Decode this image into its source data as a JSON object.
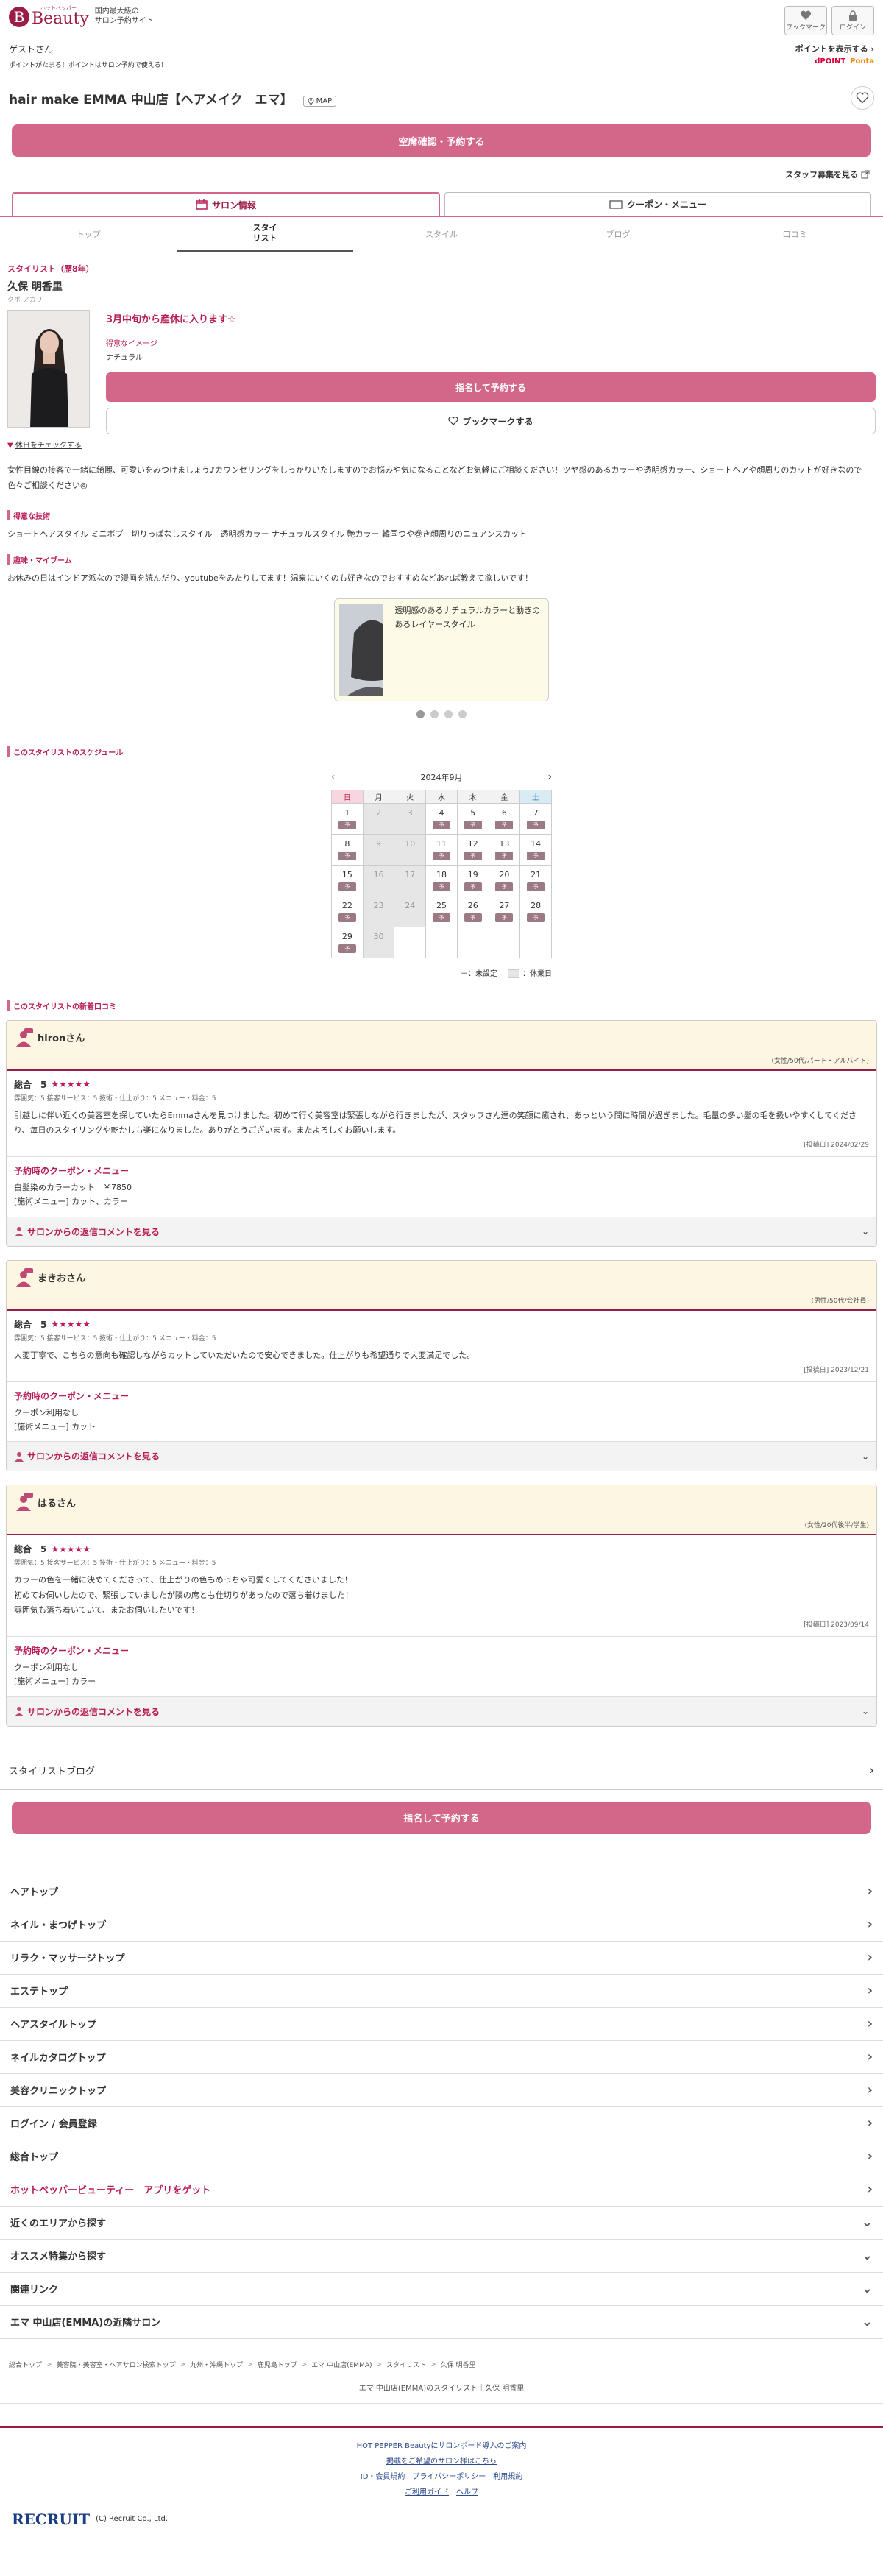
{
  "header": {
    "logo_small": "ホットペッパー",
    "logo_word": "Beauty",
    "logo_mark": "B",
    "tagline1": "国内最大級の",
    "tagline2": "サロン予約サイト",
    "bookmark": "ブックマーク",
    "login": "ログイン",
    "guest": "ゲストさん",
    "point_note": "ポイントがたまる！ポイントはサロン予約で使える！",
    "point_show": "ポイントを表示する",
    "dpoint": "dPOINT",
    "ponta": "Ponta"
  },
  "salon": {
    "name": "hair make EMMA 中山店【ヘアメイク　エマ】",
    "map": "MAP",
    "reserve": "空席確認・予約する",
    "staff_photos": "スタッフ募集を見る"
  },
  "tabs": [
    "サロン情報",
    "クーポン・メニュー"
  ],
  "subtabs": [
    "トップ",
    "スタイ\nリスト",
    "スタイル",
    "ブログ",
    "口コミ"
  ],
  "stylist": {
    "role": "スタイリスト（歴8年）",
    "name": "久保 明香里",
    "kana": "クボ アカリ",
    "catch": "3月中旬から産休に入ります☆",
    "image_label": "得意なイメージ",
    "image_value": "ナチュラル",
    "nominate": "指名して予約する",
    "bookmark": "ブックマークする",
    "holiday": "休日をチェックする",
    "pr": "女性目線の接客で一緒に綺麗、可愛いをみつけましょう♪カウンセリングをしっかりいたしますのでお悩みや気になることなどお気軽にご相談ください！ツヤ感のあるカラーや透明感カラー、ショートヘアや顔周りのカットが好きなので色々ご相談ください◎"
  },
  "skills": {
    "title": "得意な技術",
    "text": "ショートヘアスタイル ミニボブ　切りっぱなしスタイル　透明感カラー ナチュラルスタイル 艶カラー 韓国つや巻き顔周りのニュアンスカット"
  },
  "hobby": {
    "title": "趣味・マイブーム",
    "text": "お休みの日はインドア派なので漫画を読んだり、youtubeをみたりしてます！温泉にいくのも好きなのでおすすめなどあれば教えて欲しいです！"
  },
  "style_card": {
    "desc": "透明感のあるナチュラルカラーと動きのあるレイヤースタイル"
  },
  "schedule": {
    "title": "このスタイリストのスケジュール",
    "month": "2024年9月",
    "dow": [
      "日",
      "月",
      "火",
      "水",
      "木",
      "金",
      "土"
    ],
    "rows": [
      [
        [
          "1",
          "ok"
        ],
        [
          "2",
          "off"
        ],
        [
          "3",
          "off"
        ],
        [
          "4",
          "ok"
        ],
        [
          "5",
          "ok"
        ],
        [
          "6",
          "ok"
        ],
        [
          "7",
          "ok"
        ]
      ],
      [
        [
          "8",
          "ok"
        ],
        [
          "9",
          "off"
        ],
        [
          "10",
          "off"
        ],
        [
          "11",
          "ok"
        ],
        [
          "12",
          "ok"
        ],
        [
          "13",
          "ok"
        ],
        [
          "14",
          "ok"
        ]
      ],
      [
        [
          "15",
          "ok"
        ],
        [
          "16",
          "off"
        ],
        [
          "17",
          "off"
        ],
        [
          "18",
          "ok"
        ],
        [
          "19",
          "ok"
        ],
        [
          "20",
          "ok"
        ],
        [
          "21",
          "ok"
        ]
      ],
      [
        [
          "22",
          "ok"
        ],
        [
          "23",
          "off"
        ],
        [
          "24",
          "off"
        ],
        [
          "25",
          "ok"
        ],
        [
          "26",
          "ok"
        ],
        [
          "27",
          "ok"
        ],
        [
          "28",
          "ok"
        ]
      ],
      [
        [
          "29",
          "ok"
        ],
        [
          "30",
          "off"
        ],
        [
          "",
          "empty"
        ],
        [
          "",
          "empty"
        ],
        [
          "",
          "empty"
        ],
        [
          "",
          "empty"
        ],
        [
          "",
          "empty"
        ]
      ]
    ],
    "chip": "予",
    "legend_unset": "－：未設定",
    "legend_holiday": "：休業日"
  },
  "reviews": {
    "title": "このスタイリストの新着口コミ",
    "coupon_title": "予約時のクーポン・メニュー",
    "reply": "サロンからの返信コメントを見る",
    "items": [
      {
        "user": "hironさん",
        "attr": "(女性/50代/パート・アルバイト)",
        "total": "総合　5",
        "stars": "★★★★★",
        "sub": "雰囲気：5 接客サービス：5 技術・仕上がり：5 メニュー・料金：5",
        "text": "引越しに伴い近くの美容室を探していたらEmmaさんを見つけました。初めて行く美容室は緊張しながら行きましたが、スタッフさん達の笑顔に癒され、あっという間に時間が過ぎました。毛量の多い髪の毛を扱いやすくしてくださり、毎日のスタイリングや乾かしも楽になりました。ありがとうございます。またよろしくお願いします。",
        "date": "[投稿日] 2024/02/29",
        "coupon1": "白髪染めカラーカット　￥7850",
        "coupon2": "[施術メニュー] カット、カラー"
      },
      {
        "user": "まきおさん",
        "attr": "(男性/50代/会社員)",
        "total": "総合　5",
        "stars": "★★★★★",
        "sub": "雰囲気：5 接客サービス：5 技術・仕上がり：5 メニュー・料金：5",
        "text": "大変丁寧で、こちらの意向も確認しながらカットしていただいたので安心できました。仕上がりも希望通りで大変満足でした。",
        "date": "[投稿日] 2023/12/21",
        "coupon1": "クーポン利用なし",
        "coupon2": "[施術メニュー] カット"
      },
      {
        "user": "はるさん",
        "attr": "(女性/20代後半/学生)",
        "total": "総合　5",
        "stars": "★★★★★",
        "sub": "雰囲気：5 接客サービス：5 技術・仕上がり：5 メニュー・料金：5",
        "text": "カラーの色を一緒に決めてくださって、仕上がりの色もめっちゃ可愛くしてくださいました！\n初めてお伺いしたので、緊張していましたが隣の席とも仕切りがあったので落ち着けました！\n雰囲気も落ち着いていて、またお伺いしたいです！",
        "date": "[投稿日] 2023/09/14",
        "coupon1": "クーポン利用なし",
        "coupon2": "[施術メニュー] カラー"
      }
    ]
  },
  "blog_row": "スタイリストブログ",
  "bottom_nominate": "指名して予約する",
  "nav": [
    {
      "label": "ヘアトップ",
      "icon": "chevron-right",
      "pink": false
    },
    {
      "label": "ネイル・まつげトップ",
      "icon": "chevron-right",
      "pink": false
    },
    {
      "label": "リラク・マッサージトップ",
      "icon": "chevron-right",
      "pink": false
    },
    {
      "label": "エステトップ",
      "icon": "chevron-right",
      "pink": false
    },
    {
      "label": "ヘアスタイルトップ",
      "icon": "chevron-right",
      "pink": false
    },
    {
      "label": "ネイルカタログトップ",
      "icon": "chevron-right",
      "pink": false
    },
    {
      "label": "美容クリニックトップ",
      "icon": "chevron-right",
      "pink": false
    },
    {
      "label": "ログイン / 会員登録",
      "icon": "chevron-right",
      "pink": false
    },
    {
      "label": "総合トップ",
      "icon": "chevron-right",
      "pink": false
    },
    {
      "label": "ホットペッパービューティー　アプリをゲット",
      "icon": "chevron-right",
      "pink": true
    },
    {
      "label": "近くのエリアから探す",
      "icon": "chevron-down",
      "pink": false
    },
    {
      "label": "オススメ特集から探す",
      "icon": "chevron-down",
      "pink": false
    },
    {
      "label": "関連リンク",
      "icon": "chevron-down",
      "pink": false
    },
    {
      "label": "エマ 中山店(EMMA)の近隣サロン",
      "icon": "chevron-down",
      "pink": false
    }
  ],
  "breadcrumb": [
    "総合トップ",
    "美容院・美容室・ヘアサロン検索トップ",
    "九州・沖縄トップ",
    "鹿児島トップ",
    "エマ 中山店(EMMA)",
    "スタイリスト",
    "久保 明香里"
  ],
  "breadcrumb_current": "エマ 中山店(EMMA)のスタイリスト｜久保 明香里",
  "footer": {
    "link1": "HOT PEPPER Beautyにサロンボード導入のご案内",
    "link2": "掲載をご希望のサロン様はこちら",
    "link3a": "ID・会員規約",
    "link3b": "プライバシーポリシー",
    "link3c": "利用規約",
    "link4a": "ご利用ガイド",
    "link4b": "ヘルプ",
    "recruit": "RECRUIT",
    "copyright": "(C) Recruit Co., Ltd."
  },
  "colors": {
    "accent": "#d3678a",
    "brand": "#9b1d46",
    "text_pink": "#b81e56"
  }
}
